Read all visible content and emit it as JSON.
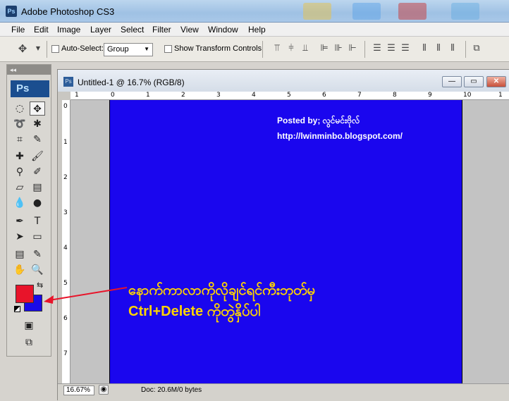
{
  "app": {
    "title": "Adobe Photoshop CS3",
    "logo": "Ps"
  },
  "menu": [
    "File",
    "Edit",
    "Image",
    "Layer",
    "Select",
    "Filter",
    "View",
    "Window",
    "Help"
  ],
  "options": {
    "auto_select_label": "Auto-Select:",
    "auto_select_value": "Group",
    "show_transform_label": "Show Transform Controls"
  },
  "toolbox": {
    "logo": "Ps",
    "header": "◂◂"
  },
  "colors": {
    "foreground": "#e8142a",
    "background": "#1a0ae8",
    "canvas": "#1a06ee",
    "annotation": "#ffd400"
  },
  "document": {
    "title": "Untitled-1 @ 16.7% (RGB/8)",
    "icon": "Ps",
    "ruler_h": [
      "1",
      "0",
      "1",
      "2",
      "3",
      "4",
      "5",
      "6",
      "7",
      "8",
      "9",
      "10",
      "1"
    ],
    "ruler_v": [
      "0",
      "1",
      "2",
      "3",
      "4",
      "5",
      "6",
      "7"
    ],
    "canvas_text": {
      "posted": "Posted by; လွင်မင်းဗိုလ်",
      "url": "http://lwinminbo.blogspot.com/"
    },
    "status": {
      "zoom": "16.67%",
      "doc_size": "Doc: 20.6M/0 bytes"
    }
  },
  "annotation": {
    "line1": "နောက်ကာလာကိုလိုချင်ရင်ကီးဘုတ်မှ",
    "line2": "Ctrl+Delete ကိုတွဲနှိပ်ပါ"
  }
}
